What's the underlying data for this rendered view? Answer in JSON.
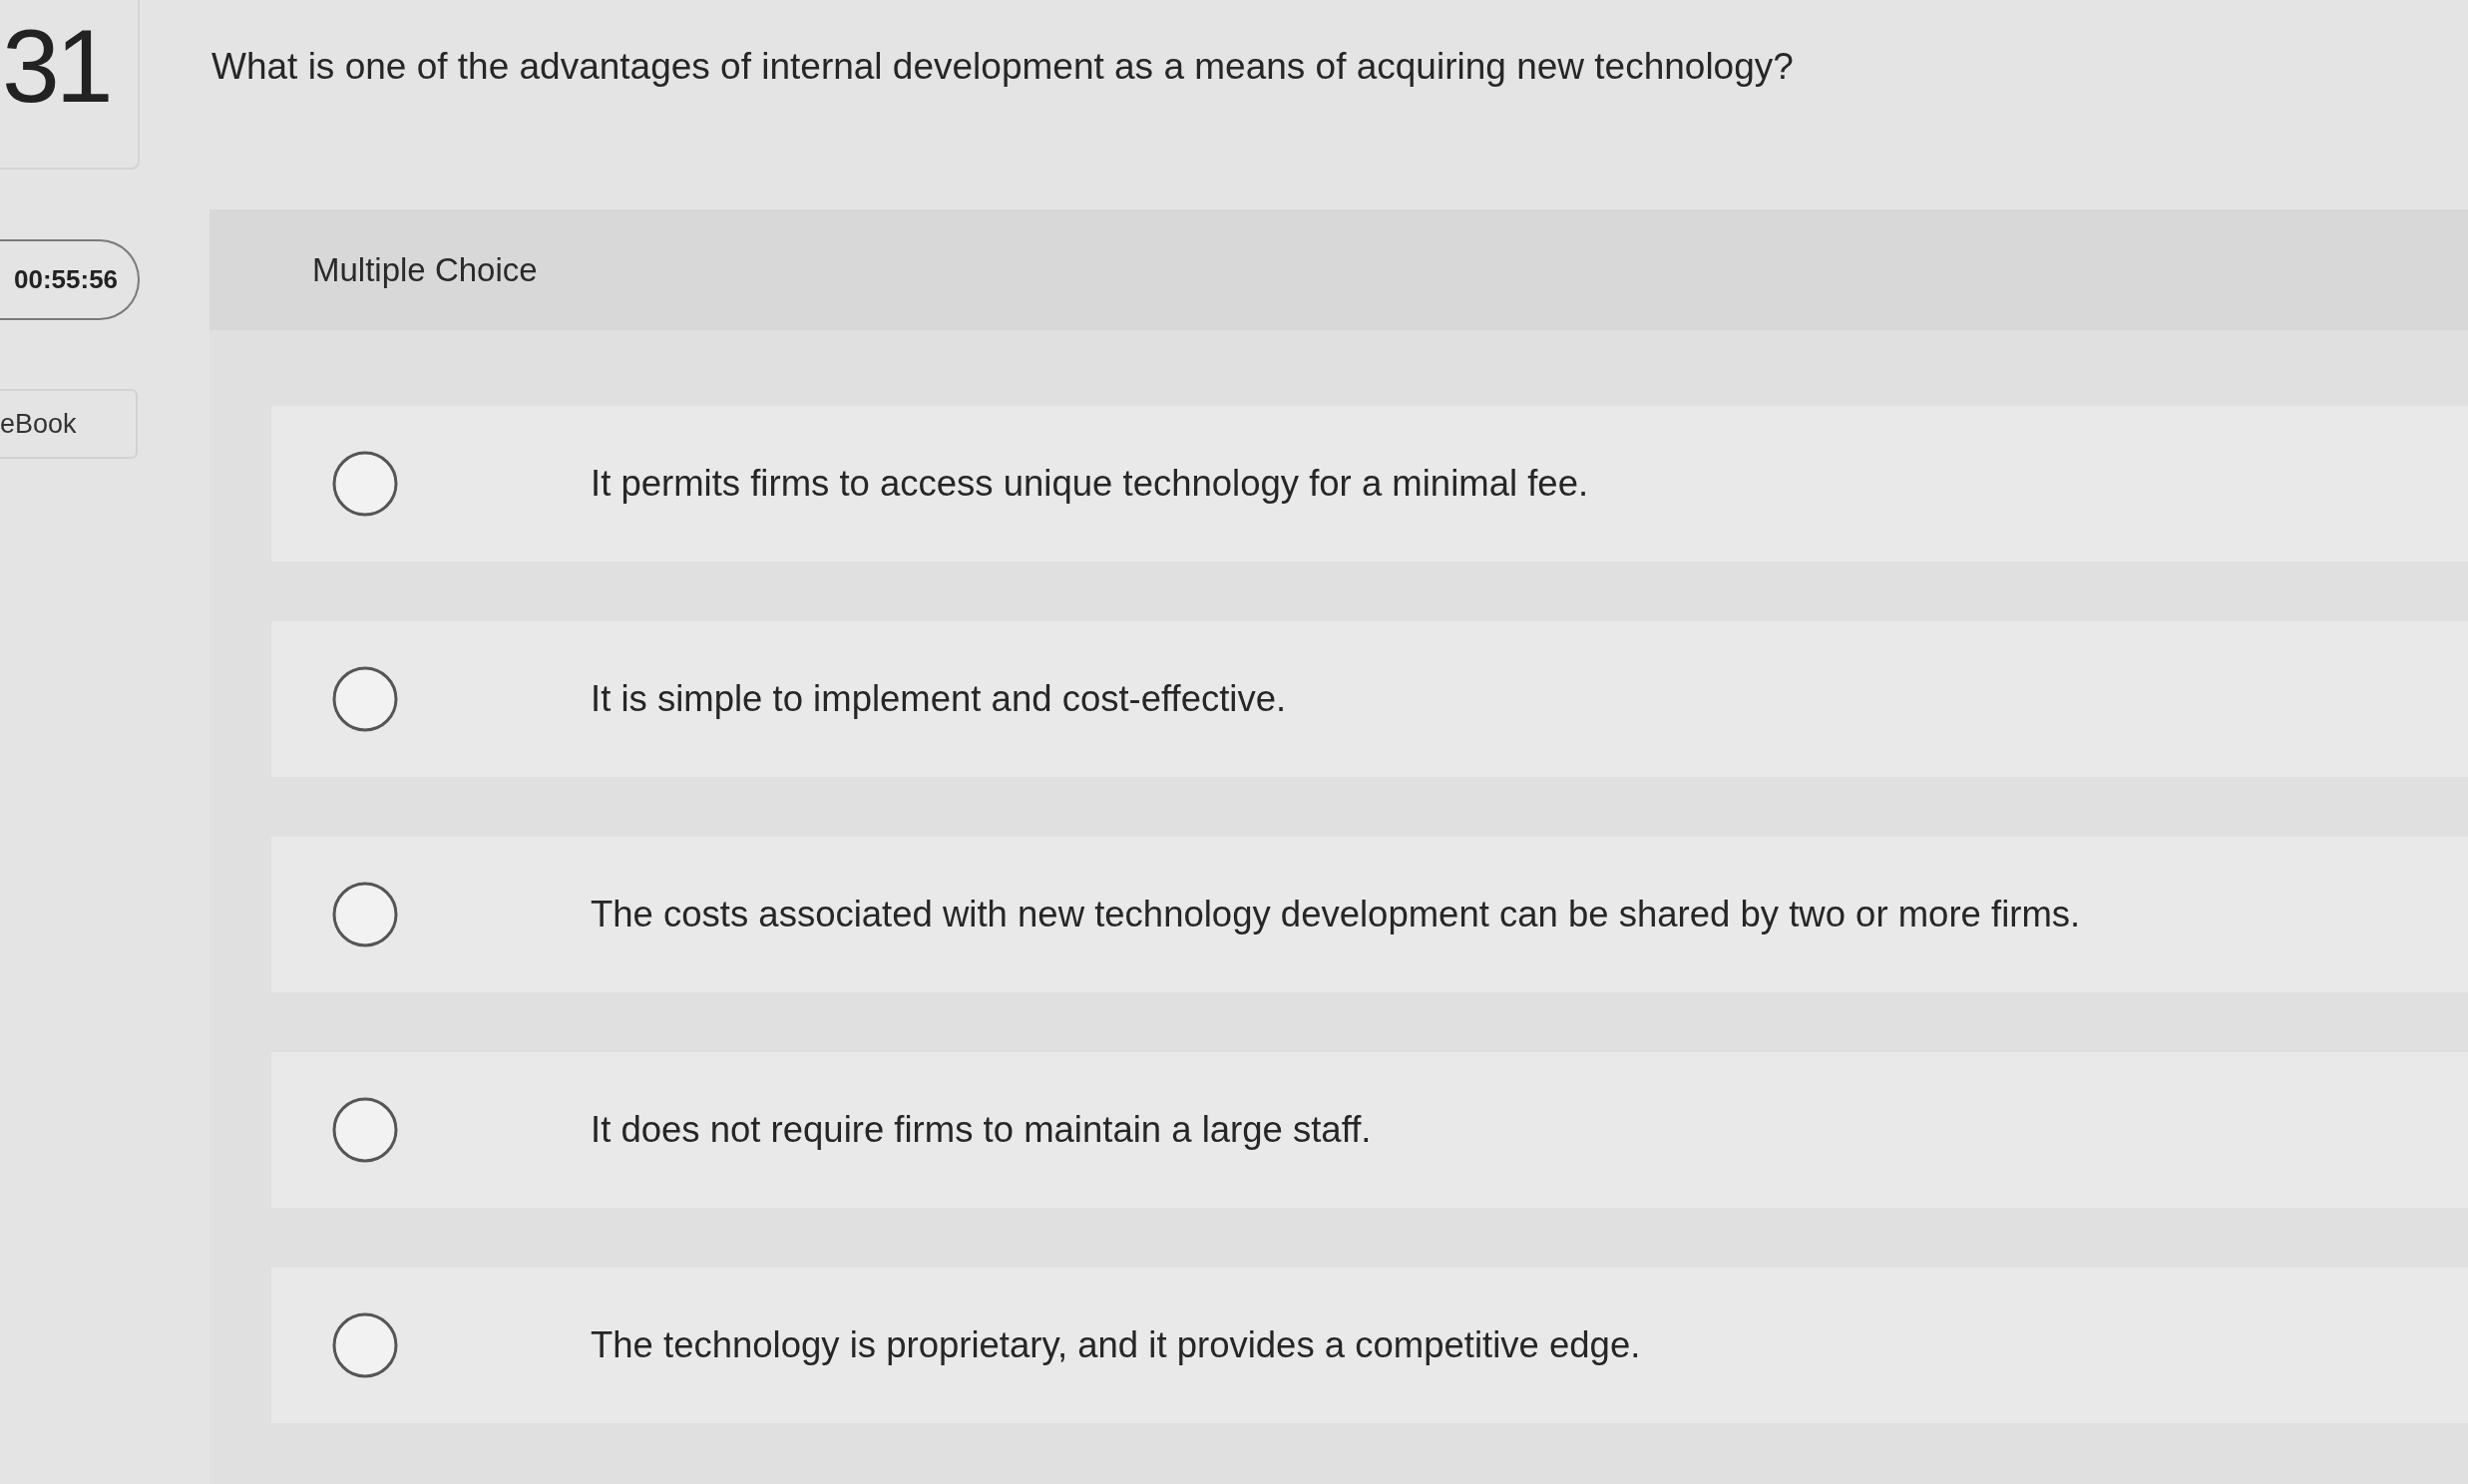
{
  "question_number": "31",
  "timer": "00:55:56",
  "ebook_link": "eBook",
  "question": "What is one of the advantages of internal development as a means of acquiring new technology?",
  "answer_panel": {
    "heading": "Multiple Choice",
    "options": [
      {
        "text": "It permits firms to access unique technology for a minimal fee.",
        "selected": false
      },
      {
        "text": "It is simple to implement and cost-effective.",
        "selected": false
      },
      {
        "text": "The costs associated with new technology development can be shared by two or more firms.",
        "selected": false
      },
      {
        "text": "It does not require firms to maintain a large staff.",
        "selected": false
      },
      {
        "text": "The technology is proprietary, and it provides a competitive edge.",
        "selected": false
      }
    ]
  }
}
